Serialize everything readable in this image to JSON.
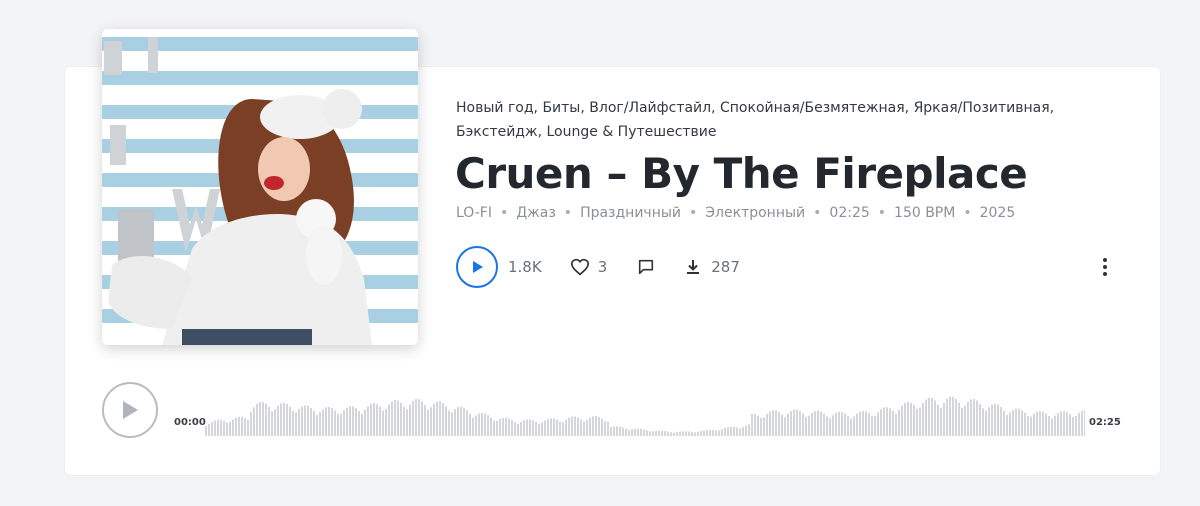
{
  "track": {
    "tags": "Новый год, Биты, Влог/Лайфстайл, Спокойная/Безмятежная, Яркая/Позитивная, Бэкстейдж, Lounge & Путешествие",
    "title": "Cruen – By The Fireplace",
    "meta": [
      "LO-FI",
      "Джаз",
      "Праздничный",
      "Электронный",
      "02:25",
      "150 BPM",
      "2025"
    ]
  },
  "stats": {
    "plays": "1.8K",
    "likes": "3",
    "downloads": "287"
  },
  "player": {
    "time_start": "00:00",
    "time_end": "02:25",
    "progress": 0
  },
  "icons": {
    "play": "play-icon",
    "like": "heart-icon",
    "comment": "comment-icon",
    "download": "download-icon",
    "more": "more-vertical-icon"
  },
  "colors": {
    "accent": "#1a73e8",
    "waveform": "#d4d6da"
  }
}
